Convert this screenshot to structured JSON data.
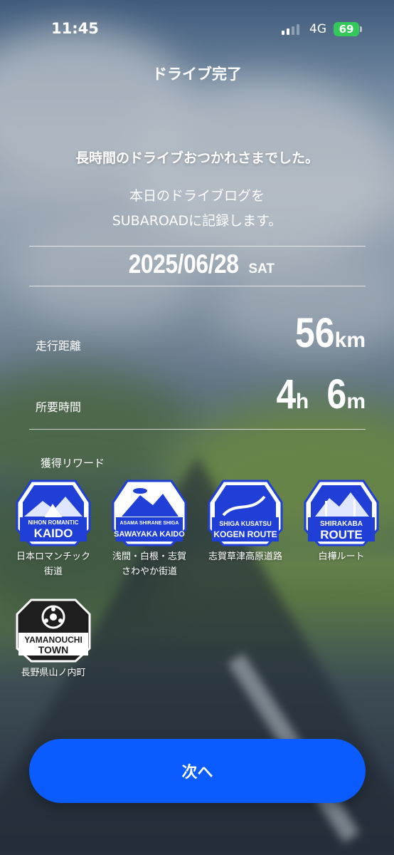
{
  "status_bar": {
    "time": "11:45",
    "network": "4G",
    "battery": "69"
  },
  "header": {
    "title": "ドライブ完了"
  },
  "message": {
    "heading": "長時間のドライブおつかれさまでした。",
    "line1": "本日のドライブログを",
    "line2": "SUBAROADに記録します。"
  },
  "drive": {
    "date": "2025/06/28",
    "weekday": "SAT",
    "distance_label": "走行距離",
    "distance_value": "56",
    "distance_unit": "km",
    "time_label": "所要時間",
    "hours_value": "4",
    "hours_unit": "h",
    "minutes_value": "6",
    "minutes_unit": "m"
  },
  "rewards": {
    "label": "獲得リワード",
    "items": [
      {
        "badge_line1": "NIHON ROMANTIC",
        "badge_line2": "KAIDO",
        "name_line1": "日本ロマンチック",
        "name_line2": "街道",
        "icon": "mountain-road-badge-icon"
      },
      {
        "badge_line1": "ASAMA SHIRANE SHIGA",
        "badge_line2": "SAWAYAKA KAIDO",
        "name_line1": "浅間・白根・志賀",
        "name_line2": "さわやか街道",
        "icon": "mountain-road-badge-icon"
      },
      {
        "badge_line1": "SHIGA KUSATSU",
        "badge_line2": "KOGEN ROUTE",
        "name_line1": "志賀草津高原道路",
        "name_line2": "",
        "icon": "mountain-road-badge-icon"
      },
      {
        "badge_line1": "SHIRAKABA",
        "badge_line2": "ROUTE",
        "name_line1": "白樺ルート",
        "name_line2": "",
        "icon": "mountain-road-badge-icon"
      },
      {
        "badge_line1": "YAMANOUCHI",
        "badge_line2": "TOWN",
        "name_line1": "長野県山ノ内町",
        "name_line2": "",
        "icon": "town-emblem-badge-icon"
      }
    ]
  },
  "actions": {
    "next_label": "次へ"
  },
  "colors": {
    "accent": "#0a5cff",
    "badge_blue": "#1f3fd6",
    "badge_dark": "#1e1e1e",
    "battery": "#34c759"
  }
}
